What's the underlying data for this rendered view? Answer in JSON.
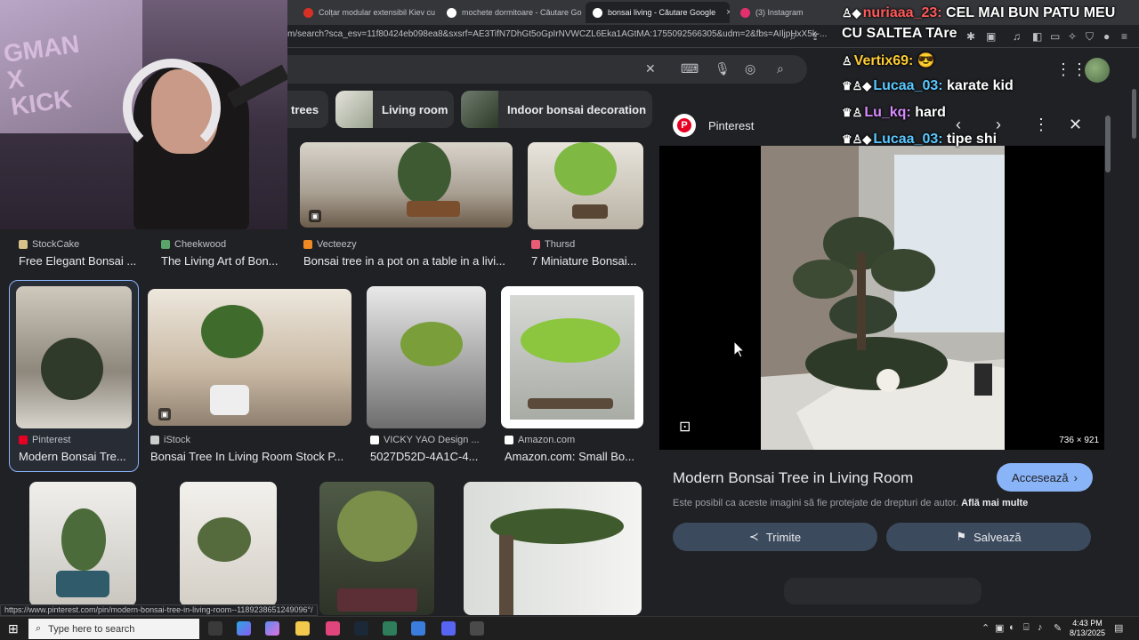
{
  "browser": {
    "tabs": [
      {
        "title": "Colțar modular extensibil Kiev cu lad...",
        "fav": "#d93025"
      },
      {
        "title": "mochete dormitoare - Căutare Google",
        "fav": "#ffffff"
      },
      {
        "title": "bonsai living - Căutare Google",
        "fav": "#ffffff",
        "active": true,
        "close": "×"
      },
      {
        "title": "(3) Instagram",
        "fav": "#e1306c"
      }
    ],
    "url": "m/search?sca_esv=11f80424eb098ea8&sxsrf=AE3TifN7DhGt5oGpIrNVWCZL6Eka1AGtMA:1755092566305&udm=2&fbs=AIljpHxX5k-..."
  },
  "search": {
    "clear_icon": "close-icon",
    "keyboard_icon": "keyboard-icon",
    "voice_icon": "mic-icon",
    "lens_icon": "lens-icon",
    "search_icon": "search-icon"
  },
  "chips": [
    {
      "label": "trees"
    },
    {
      "label": "Living room"
    },
    {
      "label": "Indoor bonsai decoration"
    }
  ],
  "results": {
    "row1": [
      {
        "source": "StockCake",
        "title": "Free Elegant Bonsai ...",
        "fav": "#d8c28a"
      },
      {
        "source": "Cheekwood",
        "title": "The Living Art of Bon...",
        "fav": "#5aa469"
      },
      {
        "source": "Vecteezy",
        "title": "Bonsai tree in a pot on a table in a livi...",
        "fav": "#f08a24"
      },
      {
        "source": "Thursd",
        "title": "7 Miniature Bonsai...",
        "fav": "#e85d75"
      }
    ],
    "row2": [
      {
        "source": "Pinterest",
        "title": "Modern Bonsai Tre...",
        "fav": "#e60023"
      },
      {
        "source": "iStock",
        "title": "Bonsai Tree In Living Room Stock P...",
        "fav": "#cccccc"
      },
      {
        "source": "VICKY YAO Design ...",
        "title": "5027D52D-4A1C-4...",
        "fav": "#ffffff"
      },
      {
        "source": "Amazon.com",
        "title": "Amazon.com: Small Bo...",
        "fav": "#ffffff"
      }
    ]
  },
  "panel": {
    "source": "Pinterest",
    "dimensions": "736 × 921",
    "title": "Modern Bonsai Tree in Living Room",
    "visit_label": "Accesează",
    "disclaimer": "Este posibil ca aceste imagini să fie protejate de drepturi de autor.",
    "learn_more": "Află mai multe",
    "share_label": "Trimite",
    "save_label": "Salvează"
  },
  "status_url": "https://www.pinterest.com/pin/modern-bonsai-tree-in-living-room--1189238651249096°/",
  "chat": [
    {
      "user": "nuriaaa_23:",
      "msg": "CEL MAI BUN PATU MEU",
      "color": "red",
      "badges": "♙◆"
    },
    {
      "user": "",
      "msg": "CU SALTEA TAre",
      "color": "red",
      "badges": ""
    },
    {
      "user": "Vertix69:",
      "msg": "😎",
      "color": "gold",
      "badges": "♙"
    },
    {
      "user": "Lucaa_03:",
      "msg": "karate kid",
      "color": "blue",
      "badges": "♛♙◆"
    },
    {
      "user": "Lu_kq:",
      "msg": "hard",
      "color": "purple",
      "badges": "♛♙"
    },
    {
      "user": "Lucaa_03:",
      "msg": "tipe shi",
      "color": "blue",
      "badges": "♛♙◆"
    }
  ],
  "taskbar": {
    "search_placeholder": "Type here to search",
    "time": "4:43 PM",
    "date": "8/13/2025"
  }
}
